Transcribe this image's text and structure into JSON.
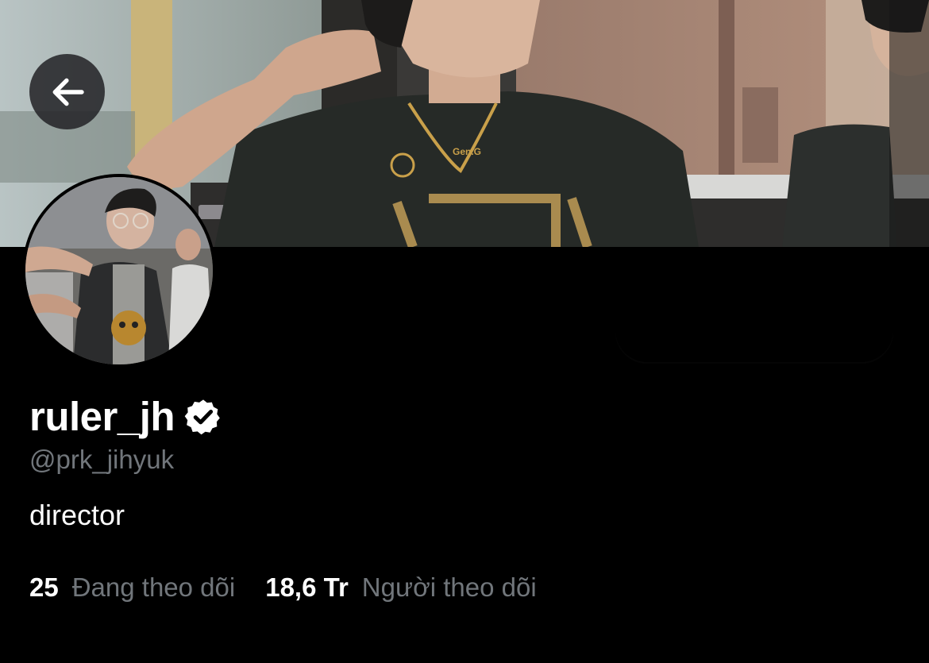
{
  "profile": {
    "display_name": "ruler_jh",
    "handle": "@prk_jihyuk",
    "bio": "director",
    "verified": true
  },
  "stats": {
    "following": {
      "value": "25",
      "label": "Đang theo dõi"
    },
    "followers": {
      "value": "18,6 Tr",
      "label": "Người theo dõi"
    }
  },
  "icons": {
    "back": "arrow-left-icon",
    "verified": "verified-badge-icon"
  },
  "colors": {
    "background": "#000000",
    "text_primary": "#ffffff",
    "text_secondary": "#71767b",
    "back_button_bg": "#232326"
  }
}
